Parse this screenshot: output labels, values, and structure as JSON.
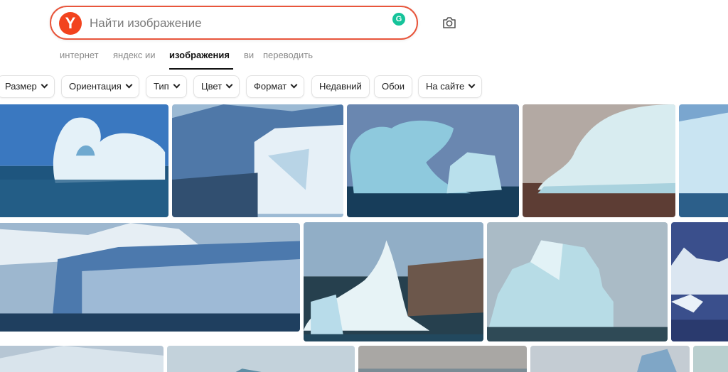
{
  "search": {
    "logo_letter": "Y",
    "placeholder": "Найти изображение",
    "value": "",
    "camera_icon": "camera-icon",
    "extension_icon": "grammarly-icon"
  },
  "tabs": [
    {
      "label": "интернет",
      "active": false
    },
    {
      "label": "яндекс ии",
      "active": false
    },
    {
      "label": "изображения",
      "active": true
    },
    {
      "label": "ви",
      "active": false
    },
    {
      "label": "переводить",
      "active": false
    }
  ],
  "filters": [
    {
      "label": "Размер",
      "dropdown": true
    },
    {
      "label": "Ориентация",
      "dropdown": true
    },
    {
      "label": "Тип",
      "dropdown": true
    },
    {
      "label": "Цвет",
      "dropdown": true
    },
    {
      "label": "Формат",
      "dropdown": true
    },
    {
      "label": "Недавний",
      "dropdown": false
    },
    {
      "label": "Обои",
      "dropdown": false
    },
    {
      "label": "На сайте",
      "dropdown": true
    }
  ],
  "results": {
    "subject": "iceberg photos",
    "colors": {
      "accent": "#e8553b",
      "logo": "#f2431e",
      "sky_blue": "#3a74b8",
      "ice": "#e6f1f7",
      "ice_shadow": "#9cc7dd",
      "sea": "#1f4f72",
      "overcast": "#b7b0a8"
    }
  }
}
